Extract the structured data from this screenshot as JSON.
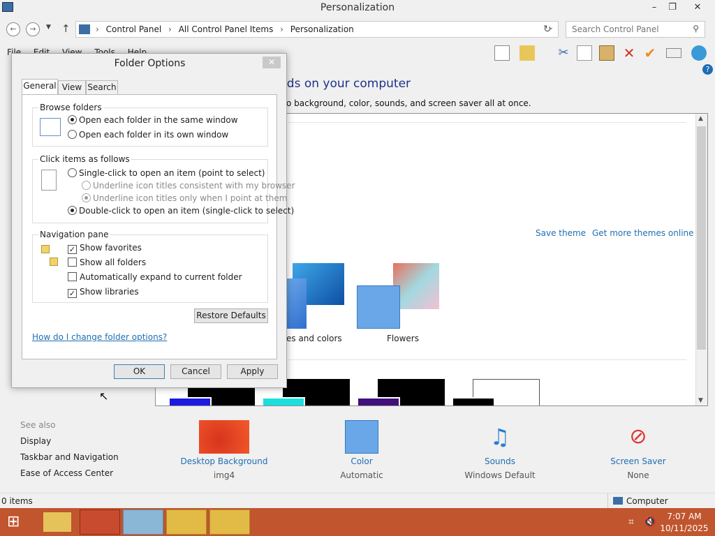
{
  "window": {
    "title": "Personalization",
    "minimize": "–",
    "maximize": "❐",
    "close": "✕"
  },
  "address": {
    "crumbs": [
      "Control Panel",
      "All Control Panel Items",
      "Personalization"
    ],
    "search_placeholder": "Search Control Panel"
  },
  "menu": [
    "File",
    "Edit",
    "View",
    "Tools",
    "Help"
  ],
  "content": {
    "header": "nds on your computer",
    "subheader": "o background, color, sounds, and screen saver all at once.",
    "save_theme": "Save theme",
    "get_more": "Get more themes online",
    "theme_labels": [
      "es and colors",
      "Flowers"
    ]
  },
  "see_also": {
    "title": "See also",
    "items": [
      "Display",
      "Taskbar and Navigation",
      "Ease of Access Center"
    ]
  },
  "bottom_items": [
    {
      "label": "Desktop Background",
      "sub": "img4"
    },
    {
      "label": "Color",
      "sub": "Automatic"
    },
    {
      "label": "Sounds",
      "sub": "Windows Default"
    },
    {
      "label": "Screen Saver",
      "sub": "None"
    }
  ],
  "status": {
    "items": "0 items",
    "location": "Computer"
  },
  "taskbar": {
    "time": "7:07 AM",
    "date": "10/11/2025"
  },
  "dialog": {
    "title": "Folder Options",
    "tabs": [
      "General",
      "View",
      "Search"
    ],
    "browse": {
      "title": "Browse folders",
      "opt1": "Open each folder in the same window",
      "opt2": "Open each folder in its own window"
    },
    "click": {
      "title": "Click items as follows",
      "opt1": "Single-click to open an item (point to select)",
      "sub1": "Underline icon titles consistent with my browser",
      "sub2": "Underline icon titles only when I point at them",
      "opt2": "Double-click to open an item (single-click to select)"
    },
    "nav": {
      "title": "Navigation pane",
      "opt1": "Show favorites",
      "opt2": "Show all folders",
      "opt3": "Automatically expand to current folder",
      "opt4": "Show libraries"
    },
    "restore": "Restore Defaults",
    "help_link": "How do I change folder options?",
    "ok": "OK",
    "cancel": "Cancel",
    "apply": "Apply"
  },
  "colors": {
    "taskbar": "#c0552e",
    "link": "#1e6eb4",
    "heading": "#1e3287"
  }
}
